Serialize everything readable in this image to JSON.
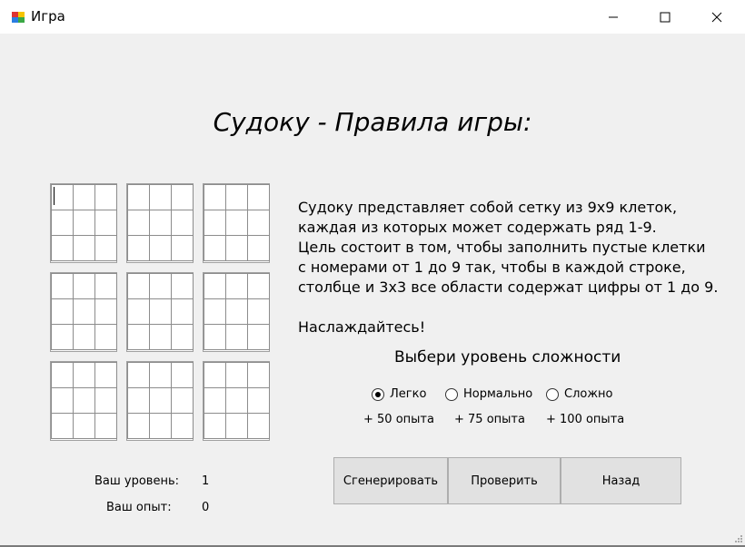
{
  "window": {
    "title": "Игра",
    "icons": [
      "app-icon",
      "minimize-icon",
      "maximize-icon",
      "close-icon"
    ]
  },
  "heading": "Судоку - Правила игры:",
  "rules": {
    "lines": [
      "Судоку представляет собой сетку из 9х9 клеток,",
      "каждая из которых может содержать ряд 1-9.",
      "Цель состоит в том, чтобы заполнить пустые клетки",
      "с номерами от 1 до 9 так, чтобы в каждой строке,",
      "столбце и 3х3 все области содержат цифры от 1 до 9."
    ],
    "enjoy": "Наслаждайтесь!"
  },
  "difficulty": {
    "label": "Выбери уровень сложности",
    "options": [
      {
        "label": "Легко",
        "xp": "+ 50 опыта",
        "selected": true
      },
      {
        "label": "Нормально",
        "xp": "+ 75 опыта",
        "selected": false
      },
      {
        "label": "Сложно",
        "xp": "+ 100 опыта",
        "selected": false
      }
    ]
  },
  "buttons": {
    "generate": "Сгенерировать",
    "check": "Проверить",
    "back": "Назад"
  },
  "stats": {
    "level_label": "Ваш уровень:",
    "level_value": "1",
    "xp_label": "Ваш опыт:",
    "xp_value": "0"
  },
  "colors": {
    "background": "#f0f0f0",
    "titlebar": "#ffffff",
    "button": "#e1e1e1"
  }
}
